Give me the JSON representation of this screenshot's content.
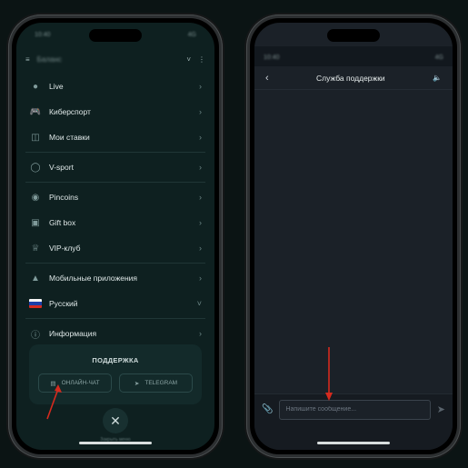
{
  "status_left": "10:40",
  "status_right": "4G",
  "left_header": {
    "account_text": "Баланс"
  },
  "menu": {
    "items": [
      {
        "label": "Live",
        "icon": "live-icon"
      },
      {
        "label": "Киберспорт",
        "icon": "gamepad-icon"
      },
      {
        "label": "Мои ставки",
        "icon": "ticket-icon"
      },
      {
        "label": "V-sport",
        "icon": "v-sport-icon"
      },
      {
        "label": "Pincoins",
        "icon": "coin-icon"
      },
      {
        "label": "Gift box",
        "icon": "gift-icon"
      },
      {
        "label": "VIP-клуб",
        "icon": "crown-icon"
      },
      {
        "label": "Мобильные приложения",
        "icon": "android-icon"
      },
      {
        "label": "Русский",
        "icon": "russia-flag-icon"
      },
      {
        "label": "Информация",
        "icon": "info-icon"
      }
    ]
  },
  "support": {
    "title": "ПОДДЕРЖКА",
    "online_chat": "ОНЛАЙН-ЧАТ",
    "telegram": "TELEGRAM"
  },
  "close_caption": "Закрыть меню",
  "chat": {
    "title": "Служба поддержки",
    "input_placeholder": "Напишите сообщение..."
  },
  "colors": {
    "accent_arrow": "#d62a1e",
    "left_bg": "#0e2020",
    "right_bg": "#1b2128"
  }
}
